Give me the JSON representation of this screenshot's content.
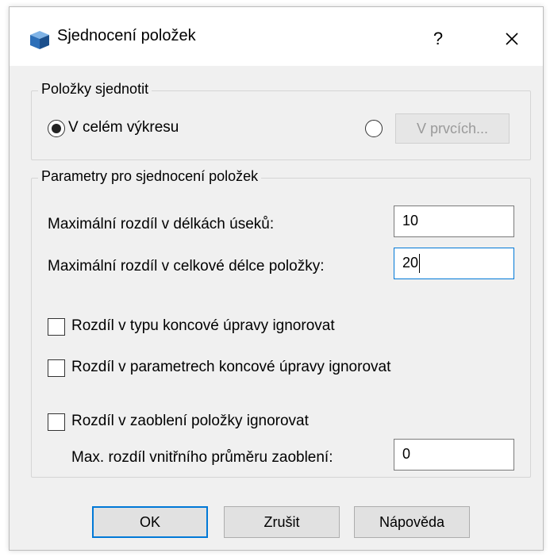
{
  "window": {
    "title": "Sjednocení položek",
    "help_symbol": "?",
    "close_icon": "close-icon",
    "app_icon": "cube-icon"
  },
  "scope_group": {
    "label": "Položky sjednotit",
    "option_drawing": "V celém výkresu",
    "option_drawing_selected": true,
    "option_elements_selected": false,
    "elements_button_label": "V prvcích..."
  },
  "params_group": {
    "label": "Parametry pro sjednocení položek",
    "max_segment_diff_label": "Maximální rozdíl v délkách úseků:",
    "max_segment_diff_value": "10",
    "max_total_diff_label": "Maximální rozdíl v celkové délce položky:",
    "max_total_diff_value": "20",
    "ignore_end_type_label": "Rozdíl v typu koncové úpravy ignorovat",
    "ignore_end_params_label": "Rozdíl v parametrech koncové úpravy ignorovat",
    "ignore_rounding_label": "Rozdíl v zaoblení položky ignorovat",
    "max_inner_diameter_label": "Max. rozdíl vnitřního průměru zaoblení:",
    "max_inner_diameter_value": "0"
  },
  "buttons": {
    "ok": "OK",
    "cancel": "Zrušit",
    "help": "Nápověda"
  },
  "colors": {
    "accent": "#0078d7",
    "dialog_bg": "#f0f0f0"
  }
}
